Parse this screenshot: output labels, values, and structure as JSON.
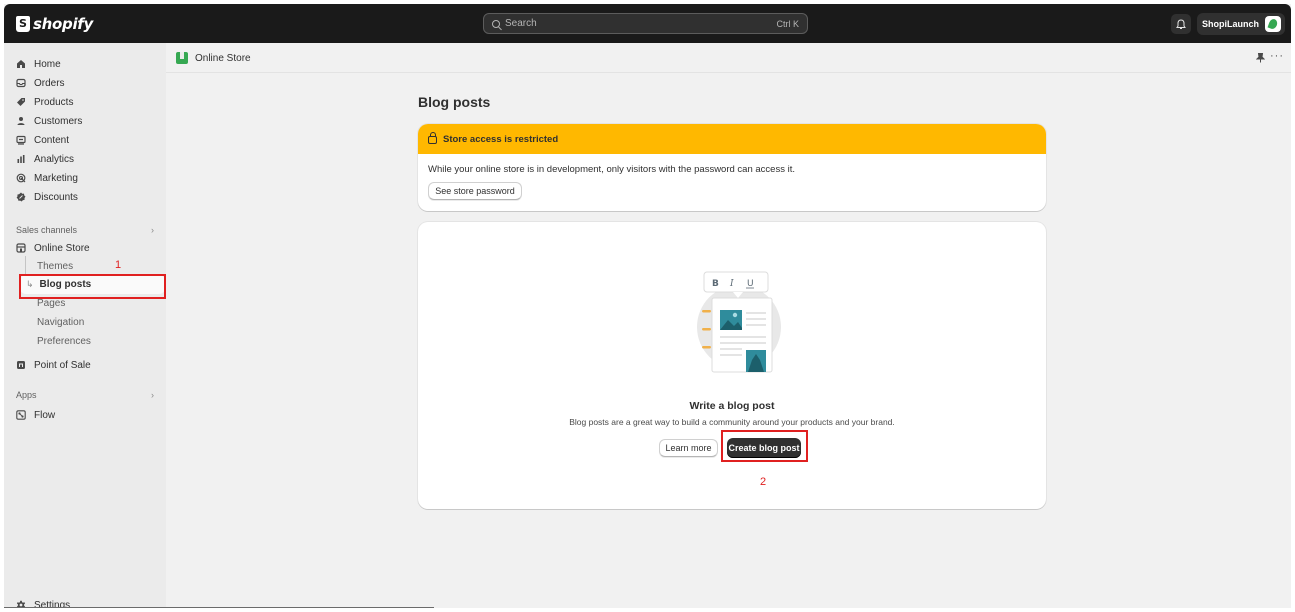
{
  "topbar": {
    "logo_text": "shopify",
    "search_placeholder": "Search",
    "search_shortcut": "Ctrl K",
    "store_name": "ShopiLaunch"
  },
  "sidebar": {
    "items": [
      {
        "label": "Home",
        "icon": "home-icon"
      },
      {
        "label": "Orders",
        "icon": "orders-icon"
      },
      {
        "label": "Products",
        "icon": "tag-icon"
      },
      {
        "label": "Customers",
        "icon": "person-icon"
      },
      {
        "label": "Content",
        "icon": "content-icon"
      },
      {
        "label": "Analytics",
        "icon": "bar-chart-icon"
      },
      {
        "label": "Marketing",
        "icon": "target-icon"
      },
      {
        "label": "Discounts",
        "icon": "discount-icon"
      }
    ],
    "sales_channels_label": "Sales channels",
    "online_store_label": "Online Store",
    "sub_items": [
      "Themes",
      "Blog posts",
      "Pages",
      "Navigation",
      "Preferences"
    ],
    "point_of_sale_label": "Point of Sale",
    "apps_label": "Apps",
    "flow_label": "Flow",
    "settings_label": "Settings"
  },
  "breadcrumb": {
    "label": "Online Store"
  },
  "page": {
    "title": "Blog posts",
    "banner": {
      "title": "Store access is restricted",
      "text": "While your online store is in development, only visitors with the password can access it.",
      "button": "See store password"
    },
    "empty_state": {
      "title": "Write a blog post",
      "description": "Blog posts are a great way to build a community around your products and your brand.",
      "learn_more": "Learn more",
      "create": "Create blog post"
    }
  },
  "annotations": {
    "first": "1",
    "second": "2"
  },
  "colors": {
    "banner": "#ffb800",
    "highlight": "#e02020",
    "topbar": "#1a1a1a"
  }
}
